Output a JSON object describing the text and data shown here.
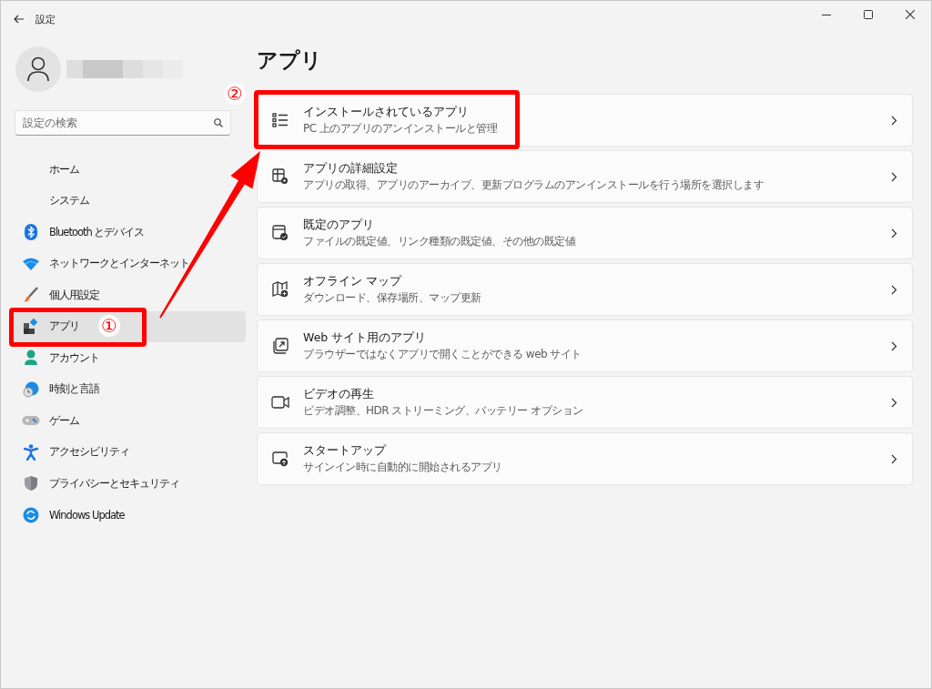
{
  "window": {
    "title": "設定"
  },
  "search": {
    "placeholder": "設定の検索"
  },
  "sidebar": {
    "items": [
      {
        "label": "ホーム",
        "selected": false
      },
      {
        "label": "システム",
        "selected": false
      },
      {
        "label": "Bluetooth とデバイス",
        "selected": false
      },
      {
        "label": "ネットワークとインターネット",
        "selected": false
      },
      {
        "label": "個人用設定",
        "selected": false
      },
      {
        "label": "アプリ",
        "selected": true
      },
      {
        "label": "アカウント",
        "selected": false
      },
      {
        "label": "時刻と言語",
        "selected": false
      },
      {
        "label": "ゲーム",
        "selected": false
      },
      {
        "label": "アクセシビリティ",
        "selected": false
      },
      {
        "label": "プライバシーとセキュリティ",
        "selected": false
      },
      {
        "label": "Windows Update",
        "selected": false
      }
    ]
  },
  "page": {
    "title": "アプリ"
  },
  "cards": [
    {
      "title": "インストールされているアプリ",
      "description": "PC 上のアプリのアンインストールと管理"
    },
    {
      "title": "アプリの詳細設定",
      "description": "アプリの取得、アプリのアーカイブ、更新プログラムのアンインストールを行う場所を選択します"
    },
    {
      "title": "既定のアプリ",
      "description": "ファイルの既定値、リンク種類の既定値、その他の既定値"
    },
    {
      "title": "オフライン マップ",
      "description": "ダウンロード、保存場所、マップ更新"
    },
    {
      "title": "Web サイト用のアプリ",
      "description": "ブラウザーではなくアプリで開くことができる web サイト"
    },
    {
      "title": "ビデオの再生",
      "description": "ビデオ調整、HDR ストリーミング、バッテリー オプション"
    },
    {
      "title": "スタートアップ",
      "description": "サインイン時に自動的に開始されるアプリ"
    }
  ],
  "annotation_markers": [
    "①",
    "②"
  ]
}
